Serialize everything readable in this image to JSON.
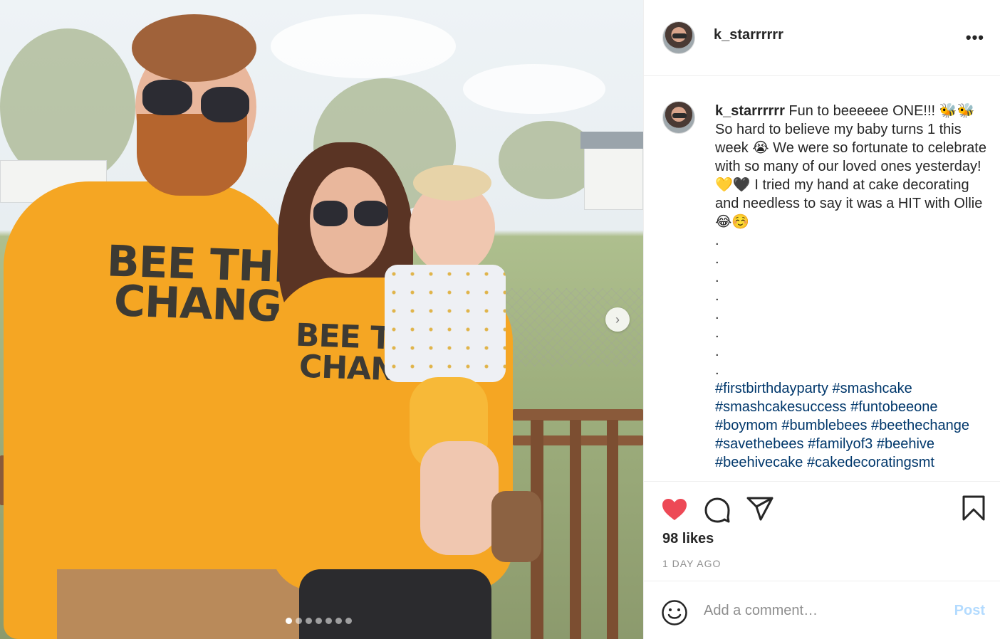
{
  "post": {
    "username": "k_starrrrrr",
    "more_icon": "more-horizontal-icon",
    "image": {
      "shirt_text_line1": "BEE THE",
      "shirt_text_line2": "CHANGE",
      "shirt_text_small1": "BEE T",
      "shirt_text_small2": "CHAN",
      "slide_count": 7,
      "active_slide": 1
    },
    "caption": {
      "username": "k_starrrrrr",
      "text": " Fun to beeeeee ONE!!! 🐝🐝 So hard to believe my baby turns 1 this week 😭 We were so fortunate to celebrate with so many of our loved ones yesterday! 💛🖤 I tried my hand at cake decorating and needless to say it was a HIT with Ollie 😂☺️",
      "dots": [
        ".",
        ".",
        ".",
        ".",
        ".",
        ".",
        ".",
        "."
      ],
      "hashtags": [
        "#firstbirthdayparty",
        "#smashcake",
        "#smashcakesuccess",
        "#funtobeeone",
        "#boymom",
        "#bumblebees",
        "#beethechange",
        "#savethebees",
        "#familyof3",
        "#beehive",
        "#beehivecake",
        "#cakedecoratingsmt"
      ]
    },
    "likes": "98 likes",
    "time_ago": "1 DAY AGO",
    "comment": {
      "placeholder": "Add a comment…",
      "post_label": "Post"
    },
    "colors": {
      "heart": "#ed4956",
      "hashtag": "#00376b",
      "post_disabled": "#b3dbff"
    }
  }
}
